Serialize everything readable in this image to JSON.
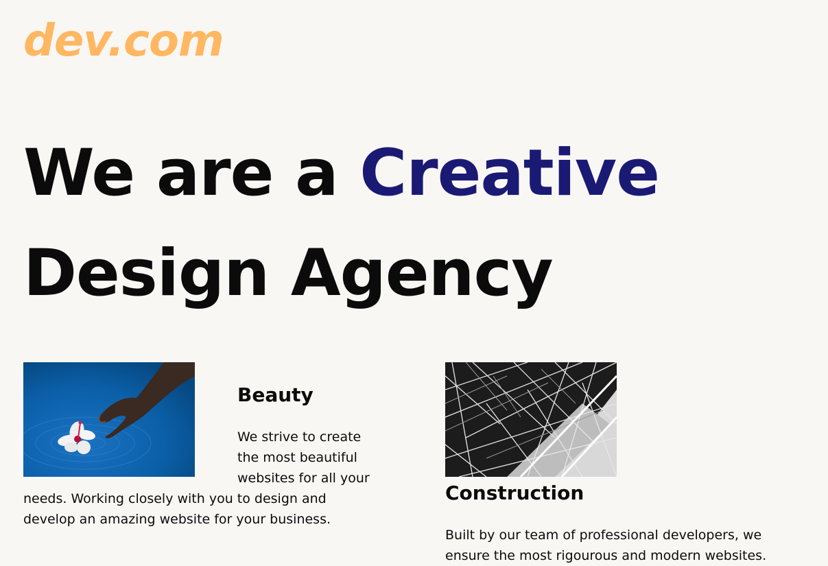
{
  "brand": {
    "logo_text": "dev.com",
    "logo_color": "#ffb762",
    "accent_color": "#1a1a75"
  },
  "hero": {
    "line1_prefix": "We are a ",
    "line1_accent": "Creative",
    "line2": "Design Agency"
  },
  "cards": [
    {
      "image": "hand-touching-water-with-flower-photo",
      "title": "Beauty",
      "text": "We strive to create the most beautiful websites for all your needs. Working closely with you to design and develop an amazing website for your business."
    },
    {
      "image": "steel-lattice-structure-photo",
      "title": "Construction",
      "text": "Built by our team of professional developers, we ensure the most rigourous and modern websites."
    }
  ]
}
